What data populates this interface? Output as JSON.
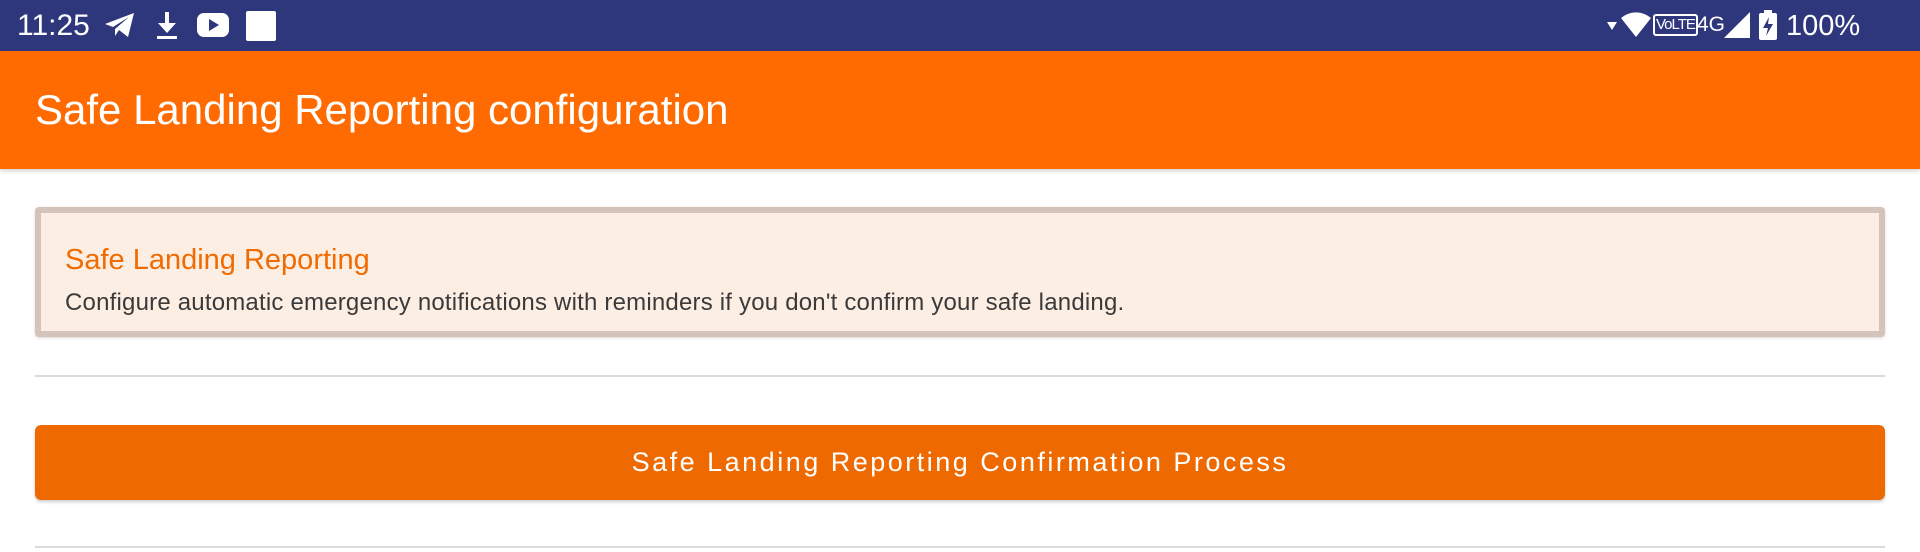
{
  "status_bar": {
    "time": "11:25",
    "left_icons": [
      "telegram-icon",
      "download-icon",
      "youtube-icon",
      "notification-square-icon"
    ],
    "right_icons": [
      "signal-indicator-icon",
      "wifi-icon",
      "volte-icon",
      "network-4g-icon",
      "cell-signal-icon",
      "battery-charging-icon"
    ],
    "volte_label": "VoLTE",
    "network_label": "4G",
    "battery_percent": "100%",
    "background_color": "#2e377c"
  },
  "app_bar": {
    "title": "Safe Landing Reporting configuration",
    "background_color": "#ff6b00"
  },
  "info_card": {
    "title": "Safe Landing Reporting",
    "description": "Configure automatic emergency notifications with reminders if you don't confirm your safe landing.",
    "title_color": "#f16b00",
    "background_color": "#fdeee4"
  },
  "action": {
    "button_label": "Safe Landing Reporting Confirmation Process",
    "button_color": "#ee6a00"
  }
}
